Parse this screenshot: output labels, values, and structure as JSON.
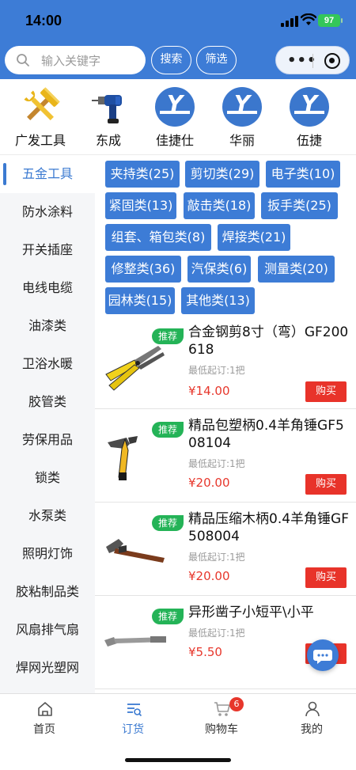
{
  "status_bar": {
    "time": "14:00",
    "battery": "97"
  },
  "search": {
    "placeholder": "输入关键字",
    "search_label": "搜索",
    "filter_label": "筛选"
  },
  "capsule": {
    "more_icon": "more-dots-icon",
    "close_icon": "target-circle-icon"
  },
  "brands": [
    {
      "name": "广发工具",
      "icon": "hammer-wrench-icon"
    },
    {
      "name": "东成",
      "icon": "drill-icon"
    },
    {
      "name": "佳捷仕",
      "icon": "brand-y-logo"
    },
    {
      "name": "华丽",
      "icon": "brand-y-logo"
    },
    {
      "name": "伍捷",
      "icon": "brand-y-logo"
    }
  ],
  "sidebar": {
    "items": [
      "五金工具",
      "防水涂料",
      "开关插座",
      "电线电缆",
      "油漆类",
      "卫浴水暖",
      "胶管类",
      "劳保用品",
      "锁类",
      "水泵类",
      "照明灯饰",
      "胶粘制品类",
      "风扇排气扇",
      "焊网光塑网"
    ],
    "active_index": 0
  },
  "subcategories": [
    "夹持类(25)",
    "剪切类(29)",
    "电子类(10)",
    "紧固类(13)",
    "敲击类(18)",
    "扳手类(25)",
    "组套、箱包类(8)",
    "焊接类(21)",
    "修整类(36)",
    "汽保类(6)",
    "测量类(20)",
    "园林类(15)",
    "其他类(13)"
  ],
  "products": [
    {
      "badge": "推荐",
      "title": "合金钢剪8寸（弯）GF200618",
      "min_order": "最低起订:1把",
      "price": "¥14.00",
      "buy": "购买",
      "image": "pliers-shears-image"
    },
    {
      "badge": "推荐",
      "title": "精品包塑柄0.4羊角锤GF508104",
      "min_order": "最低起订:1把",
      "price": "¥20.00",
      "buy": "购买",
      "image": "claw-hammer-yellow-image"
    },
    {
      "badge": "推荐",
      "title": "精品压缩木柄0.4羊角锤GF508004",
      "min_order": "最低起订:1把",
      "price": "¥20.00",
      "buy": "购买",
      "image": "claw-hammer-wood-image"
    },
    {
      "badge": "推荐",
      "title": "异形凿子小短平\\小平",
      "min_order": "最低起订:1把",
      "price": "¥5.50",
      "buy": "购买",
      "image": "chisel-image"
    }
  ],
  "tabbar": {
    "items": [
      {
        "label": "首页",
        "icon": "home-icon"
      },
      {
        "label": "订货",
        "icon": "order-list-icon"
      },
      {
        "label": "购物车",
        "icon": "cart-icon"
      },
      {
        "label": "我的",
        "icon": "user-icon"
      }
    ],
    "active_index": 1,
    "cart_count": "6"
  },
  "colors": {
    "primary": "#3d7cd6",
    "price": "#e7372c",
    "badge": "#24b357"
  }
}
